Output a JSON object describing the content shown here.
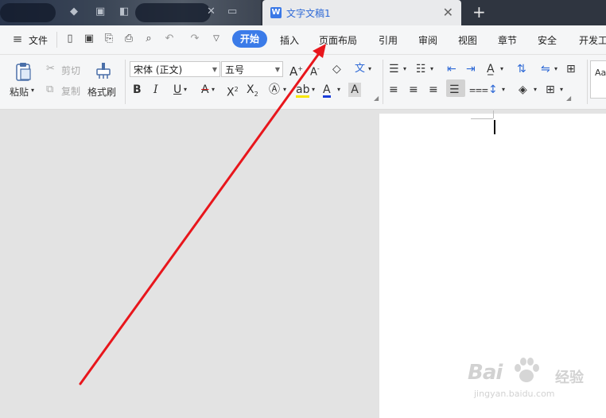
{
  "tabbar": {
    "doc_tab_title": "文字文稿1",
    "doc_icon_letter": "W",
    "close_glyph": "✕",
    "new_tab_glyph": "+"
  },
  "menubar": {
    "file_label": "文件",
    "tabs": [
      "开始",
      "插入",
      "页面布局",
      "引用",
      "审阅",
      "视图",
      "章节",
      "安全",
      "开发工"
    ],
    "active_tab": "开始"
  },
  "ribbon": {
    "paste_label": "粘贴",
    "cut_label": "剪切",
    "copy_label": "复制",
    "format_painter_label": "格式刷",
    "font_name": "宋体 (正文)",
    "font_size": "五号",
    "styles_preview": "Aa"
  },
  "watermark": {
    "brand": "Bai",
    "brand_cn": "经验",
    "url": "jingyan.baidu.com"
  },
  "colors": {
    "accent": "#3b7be8",
    "arrow": "#e8161c",
    "font_color": "#1a3dd8",
    "highlight": "#f7e600"
  }
}
